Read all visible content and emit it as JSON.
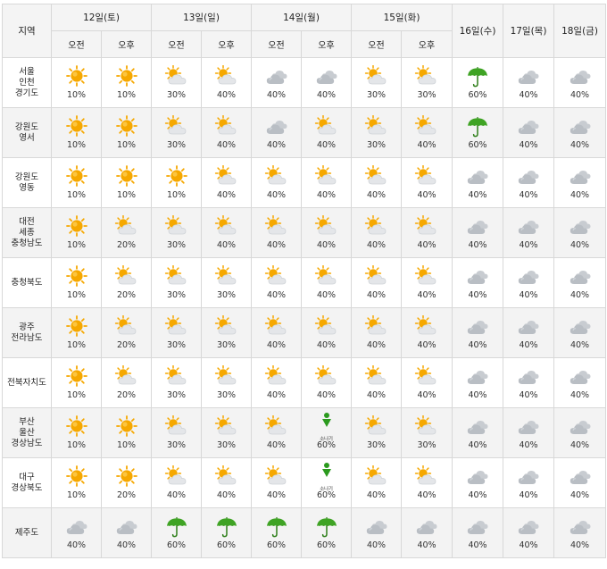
{
  "header": {
    "region_label": "지역",
    "days": [
      {
        "label": "12일(토)",
        "split": true
      },
      {
        "label": "13일(일)",
        "split": true
      },
      {
        "label": "14일(월)",
        "split": true
      },
      {
        "label": "15일(화)",
        "split": true
      },
      {
        "label": "16일(수)",
        "split": false
      },
      {
        "label": "17일(목)",
        "split": false
      },
      {
        "label": "18일(금)",
        "split": false
      }
    ],
    "am_label": "오전",
    "pm_label": "오후"
  },
  "colors": {
    "sun": "#f6a800",
    "cloud": "#b9bec4",
    "umbrella": "#3fa324",
    "shower": "#2b9a1e"
  },
  "rows": [
    {
      "region": [
        "서울",
        "인천",
        "경기도"
      ],
      "cells": [
        {
          "icon": "sun-icon",
          "pct": "10%"
        },
        {
          "icon": "sun-icon",
          "pct": "10%"
        },
        {
          "icon": "partly-cloudy-icon",
          "pct": "30%"
        },
        {
          "icon": "partly-cloudy-icon",
          "pct": "40%"
        },
        {
          "icon": "cloudy-icon",
          "pct": "40%"
        },
        {
          "icon": "cloudy-icon",
          "pct": "40%"
        },
        {
          "icon": "partly-cloudy-icon",
          "pct": "30%"
        },
        {
          "icon": "partly-cloudy-icon",
          "pct": "30%"
        },
        {
          "icon": "rain-icon",
          "pct": "60%"
        },
        {
          "icon": "cloudy-icon",
          "pct": "40%"
        },
        {
          "icon": "cloudy-icon",
          "pct": "40%"
        }
      ]
    },
    {
      "region": [
        "강원도",
        "영서"
      ],
      "cells": [
        {
          "icon": "sun-icon",
          "pct": "10%"
        },
        {
          "icon": "sun-icon",
          "pct": "10%"
        },
        {
          "icon": "partly-cloudy-icon",
          "pct": "30%"
        },
        {
          "icon": "partly-cloudy-icon",
          "pct": "40%"
        },
        {
          "icon": "cloudy-icon",
          "pct": "40%"
        },
        {
          "icon": "partly-cloudy-icon",
          "pct": "40%"
        },
        {
          "icon": "partly-cloudy-icon",
          "pct": "30%"
        },
        {
          "icon": "partly-cloudy-icon",
          "pct": "40%"
        },
        {
          "icon": "rain-icon",
          "pct": "60%"
        },
        {
          "icon": "cloudy-icon",
          "pct": "40%"
        },
        {
          "icon": "cloudy-icon",
          "pct": "40%"
        }
      ]
    },
    {
      "region": [
        "강원도",
        "영동"
      ],
      "cells": [
        {
          "icon": "sun-icon",
          "pct": "10%"
        },
        {
          "icon": "sun-icon",
          "pct": "10%"
        },
        {
          "icon": "sun-icon",
          "pct": "10%"
        },
        {
          "icon": "partly-cloudy-icon",
          "pct": "40%"
        },
        {
          "icon": "partly-cloudy-icon",
          "pct": "40%"
        },
        {
          "icon": "partly-cloudy-icon",
          "pct": "40%"
        },
        {
          "icon": "partly-cloudy-icon",
          "pct": "40%"
        },
        {
          "icon": "partly-cloudy-icon",
          "pct": "40%"
        },
        {
          "icon": "cloudy-icon",
          "pct": "40%"
        },
        {
          "icon": "cloudy-icon",
          "pct": "40%"
        },
        {
          "icon": "cloudy-icon",
          "pct": "40%"
        }
      ]
    },
    {
      "region": [
        "대전",
        "세종",
        "충청남도"
      ],
      "cells": [
        {
          "icon": "sun-icon",
          "pct": "10%"
        },
        {
          "icon": "partly-cloudy-icon",
          "pct": "20%"
        },
        {
          "icon": "partly-cloudy-icon",
          "pct": "30%"
        },
        {
          "icon": "partly-cloudy-icon",
          "pct": "40%"
        },
        {
          "icon": "partly-cloudy-icon",
          "pct": "40%"
        },
        {
          "icon": "partly-cloudy-icon",
          "pct": "40%"
        },
        {
          "icon": "partly-cloudy-icon",
          "pct": "40%"
        },
        {
          "icon": "partly-cloudy-icon",
          "pct": "40%"
        },
        {
          "icon": "cloudy-icon",
          "pct": "40%"
        },
        {
          "icon": "cloudy-icon",
          "pct": "40%"
        },
        {
          "icon": "cloudy-icon",
          "pct": "40%"
        }
      ]
    },
    {
      "region": [
        "충청북도"
      ],
      "cells": [
        {
          "icon": "sun-icon",
          "pct": "10%"
        },
        {
          "icon": "partly-cloudy-icon",
          "pct": "20%"
        },
        {
          "icon": "partly-cloudy-icon",
          "pct": "30%"
        },
        {
          "icon": "partly-cloudy-icon",
          "pct": "30%"
        },
        {
          "icon": "partly-cloudy-icon",
          "pct": "40%"
        },
        {
          "icon": "partly-cloudy-icon",
          "pct": "40%"
        },
        {
          "icon": "partly-cloudy-icon",
          "pct": "40%"
        },
        {
          "icon": "partly-cloudy-icon",
          "pct": "40%"
        },
        {
          "icon": "cloudy-icon",
          "pct": "40%"
        },
        {
          "icon": "cloudy-icon",
          "pct": "40%"
        },
        {
          "icon": "cloudy-icon",
          "pct": "40%"
        }
      ]
    },
    {
      "region": [
        "광주",
        "전라남도"
      ],
      "cells": [
        {
          "icon": "sun-icon",
          "pct": "10%"
        },
        {
          "icon": "partly-cloudy-icon",
          "pct": "20%"
        },
        {
          "icon": "partly-cloudy-icon",
          "pct": "30%"
        },
        {
          "icon": "partly-cloudy-icon",
          "pct": "30%"
        },
        {
          "icon": "partly-cloudy-icon",
          "pct": "40%"
        },
        {
          "icon": "partly-cloudy-icon",
          "pct": "40%"
        },
        {
          "icon": "partly-cloudy-icon",
          "pct": "40%"
        },
        {
          "icon": "partly-cloudy-icon",
          "pct": "40%"
        },
        {
          "icon": "cloudy-icon",
          "pct": "40%"
        },
        {
          "icon": "cloudy-icon",
          "pct": "40%"
        },
        {
          "icon": "cloudy-icon",
          "pct": "40%"
        }
      ]
    },
    {
      "region": [
        "전북자치도"
      ],
      "cells": [
        {
          "icon": "sun-icon",
          "pct": "10%"
        },
        {
          "icon": "partly-cloudy-icon",
          "pct": "20%"
        },
        {
          "icon": "partly-cloudy-icon",
          "pct": "30%"
        },
        {
          "icon": "partly-cloudy-icon",
          "pct": "30%"
        },
        {
          "icon": "partly-cloudy-icon",
          "pct": "40%"
        },
        {
          "icon": "partly-cloudy-icon",
          "pct": "40%"
        },
        {
          "icon": "partly-cloudy-icon",
          "pct": "40%"
        },
        {
          "icon": "partly-cloudy-icon",
          "pct": "40%"
        },
        {
          "icon": "cloudy-icon",
          "pct": "40%"
        },
        {
          "icon": "cloudy-icon",
          "pct": "40%"
        },
        {
          "icon": "cloudy-icon",
          "pct": "40%"
        }
      ]
    },
    {
      "region": [
        "부산",
        "울산",
        "경상남도"
      ],
      "cells": [
        {
          "icon": "sun-icon",
          "pct": "10%"
        },
        {
          "icon": "sun-icon",
          "pct": "10%"
        },
        {
          "icon": "partly-cloudy-icon",
          "pct": "30%"
        },
        {
          "icon": "partly-cloudy-icon",
          "pct": "30%"
        },
        {
          "icon": "partly-cloudy-icon",
          "pct": "40%"
        },
        {
          "icon": "shower-icon",
          "pct": "60%",
          "label": "소나기"
        },
        {
          "icon": "partly-cloudy-icon",
          "pct": "30%"
        },
        {
          "icon": "partly-cloudy-icon",
          "pct": "30%"
        },
        {
          "icon": "cloudy-icon",
          "pct": "40%"
        },
        {
          "icon": "cloudy-icon",
          "pct": "40%"
        },
        {
          "icon": "cloudy-icon",
          "pct": "40%"
        }
      ]
    },
    {
      "region": [
        "대구",
        "경상북도"
      ],
      "cells": [
        {
          "icon": "sun-icon",
          "pct": "10%"
        },
        {
          "icon": "sun-icon",
          "pct": "20%"
        },
        {
          "icon": "partly-cloudy-icon",
          "pct": "40%"
        },
        {
          "icon": "partly-cloudy-icon",
          "pct": "40%"
        },
        {
          "icon": "partly-cloudy-icon",
          "pct": "40%"
        },
        {
          "icon": "shower-icon",
          "pct": "60%",
          "label": "소나기"
        },
        {
          "icon": "partly-cloudy-icon",
          "pct": "40%"
        },
        {
          "icon": "partly-cloudy-icon",
          "pct": "40%"
        },
        {
          "icon": "cloudy-icon",
          "pct": "40%"
        },
        {
          "icon": "cloudy-icon",
          "pct": "40%"
        },
        {
          "icon": "cloudy-icon",
          "pct": "40%"
        }
      ]
    },
    {
      "region": [
        "제주도"
      ],
      "cells": [
        {
          "icon": "cloudy-icon",
          "pct": "40%"
        },
        {
          "icon": "cloudy-icon",
          "pct": "40%"
        },
        {
          "icon": "rain-icon",
          "pct": "60%"
        },
        {
          "icon": "rain-icon",
          "pct": "60%"
        },
        {
          "icon": "rain-icon",
          "pct": "60%"
        },
        {
          "icon": "rain-icon",
          "pct": "60%"
        },
        {
          "icon": "cloudy-icon",
          "pct": "40%"
        },
        {
          "icon": "cloudy-icon",
          "pct": "40%"
        },
        {
          "icon": "cloudy-icon",
          "pct": "40%"
        },
        {
          "icon": "cloudy-icon",
          "pct": "40%"
        },
        {
          "icon": "cloudy-icon",
          "pct": "40%"
        }
      ]
    }
  ]
}
